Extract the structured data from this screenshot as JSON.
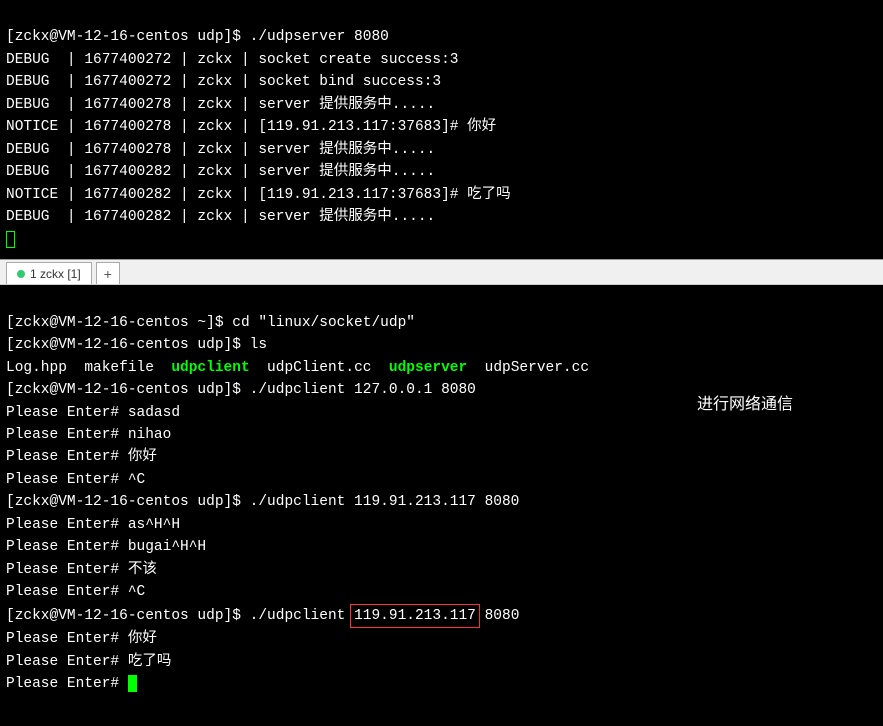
{
  "top": {
    "l0": "[zckx@VM-12-16-centos udp]$ ./udpserver 8080",
    "l1": "DEBUG  | 1677400272 | zckx | socket create success:3",
    "l2": "DEBUG  | 1677400272 | zckx | socket bind success:3",
    "l3": "DEBUG  | 1677400278 | zckx | server 提供服务中.....",
    "l4": "NOTICE | 1677400278 | zckx | [119.91.213.117:37683]# 你好",
    "l5": "DEBUG  | 1677400278 | zckx | server 提供服务中.....",
    "l6": "DEBUG  | 1677400282 | zckx | server 提供服务中.....",
    "l7": "NOTICE | 1677400282 | zckx | [119.91.213.117:37683]# 吃了吗",
    "l8": "DEBUG  | 1677400282 | zckx | server 提供服务中....."
  },
  "tabs": {
    "tab1": "1 zckx [1]",
    "newtab": "+"
  },
  "bottom": {
    "l0_a": "[zckx@VM-12-16-centos ~]$ cd \"linux/socket/udp\"",
    "l1_a": "[zckx@VM-12-16-centos udp]$ ls",
    "ls_pre": "Log.hpp  makefile  ",
    "ls_udpclient": "udpclient",
    "ls_mid1": "  udpClient.cc  ",
    "ls_udpserver": "udpserver",
    "ls_mid2": "  udpServer.cc",
    "l3": "[zckx@VM-12-16-centos udp]$ ./udpclient 127.0.0.1 8080",
    "l4": "Please Enter# sadasd",
    "l5": "Please Enter# nihao",
    "l6": "Please Enter# 你好",
    "l7": "Please Enter# ^C",
    "l8": "[zckx@VM-12-16-centos udp]$ ./udpclient 119.91.213.117 8080",
    "l9": "Please Enter# as^H^H",
    "l10": "Please Enter# bugai^H^H",
    "l11": "Please Enter# 不该",
    "l12": "Please Enter# ^C",
    "l13_pre": "[zckx@VM-12-16-centos udp]$ ./udpclient ",
    "l13_box": "119.91.213.117",
    "l13_post": " 8080",
    "l14": "Please Enter# 你好",
    "l15": "Please Enter# 吃了吗",
    "l16": "Please Enter# "
  },
  "annotation": "进行网络通信"
}
